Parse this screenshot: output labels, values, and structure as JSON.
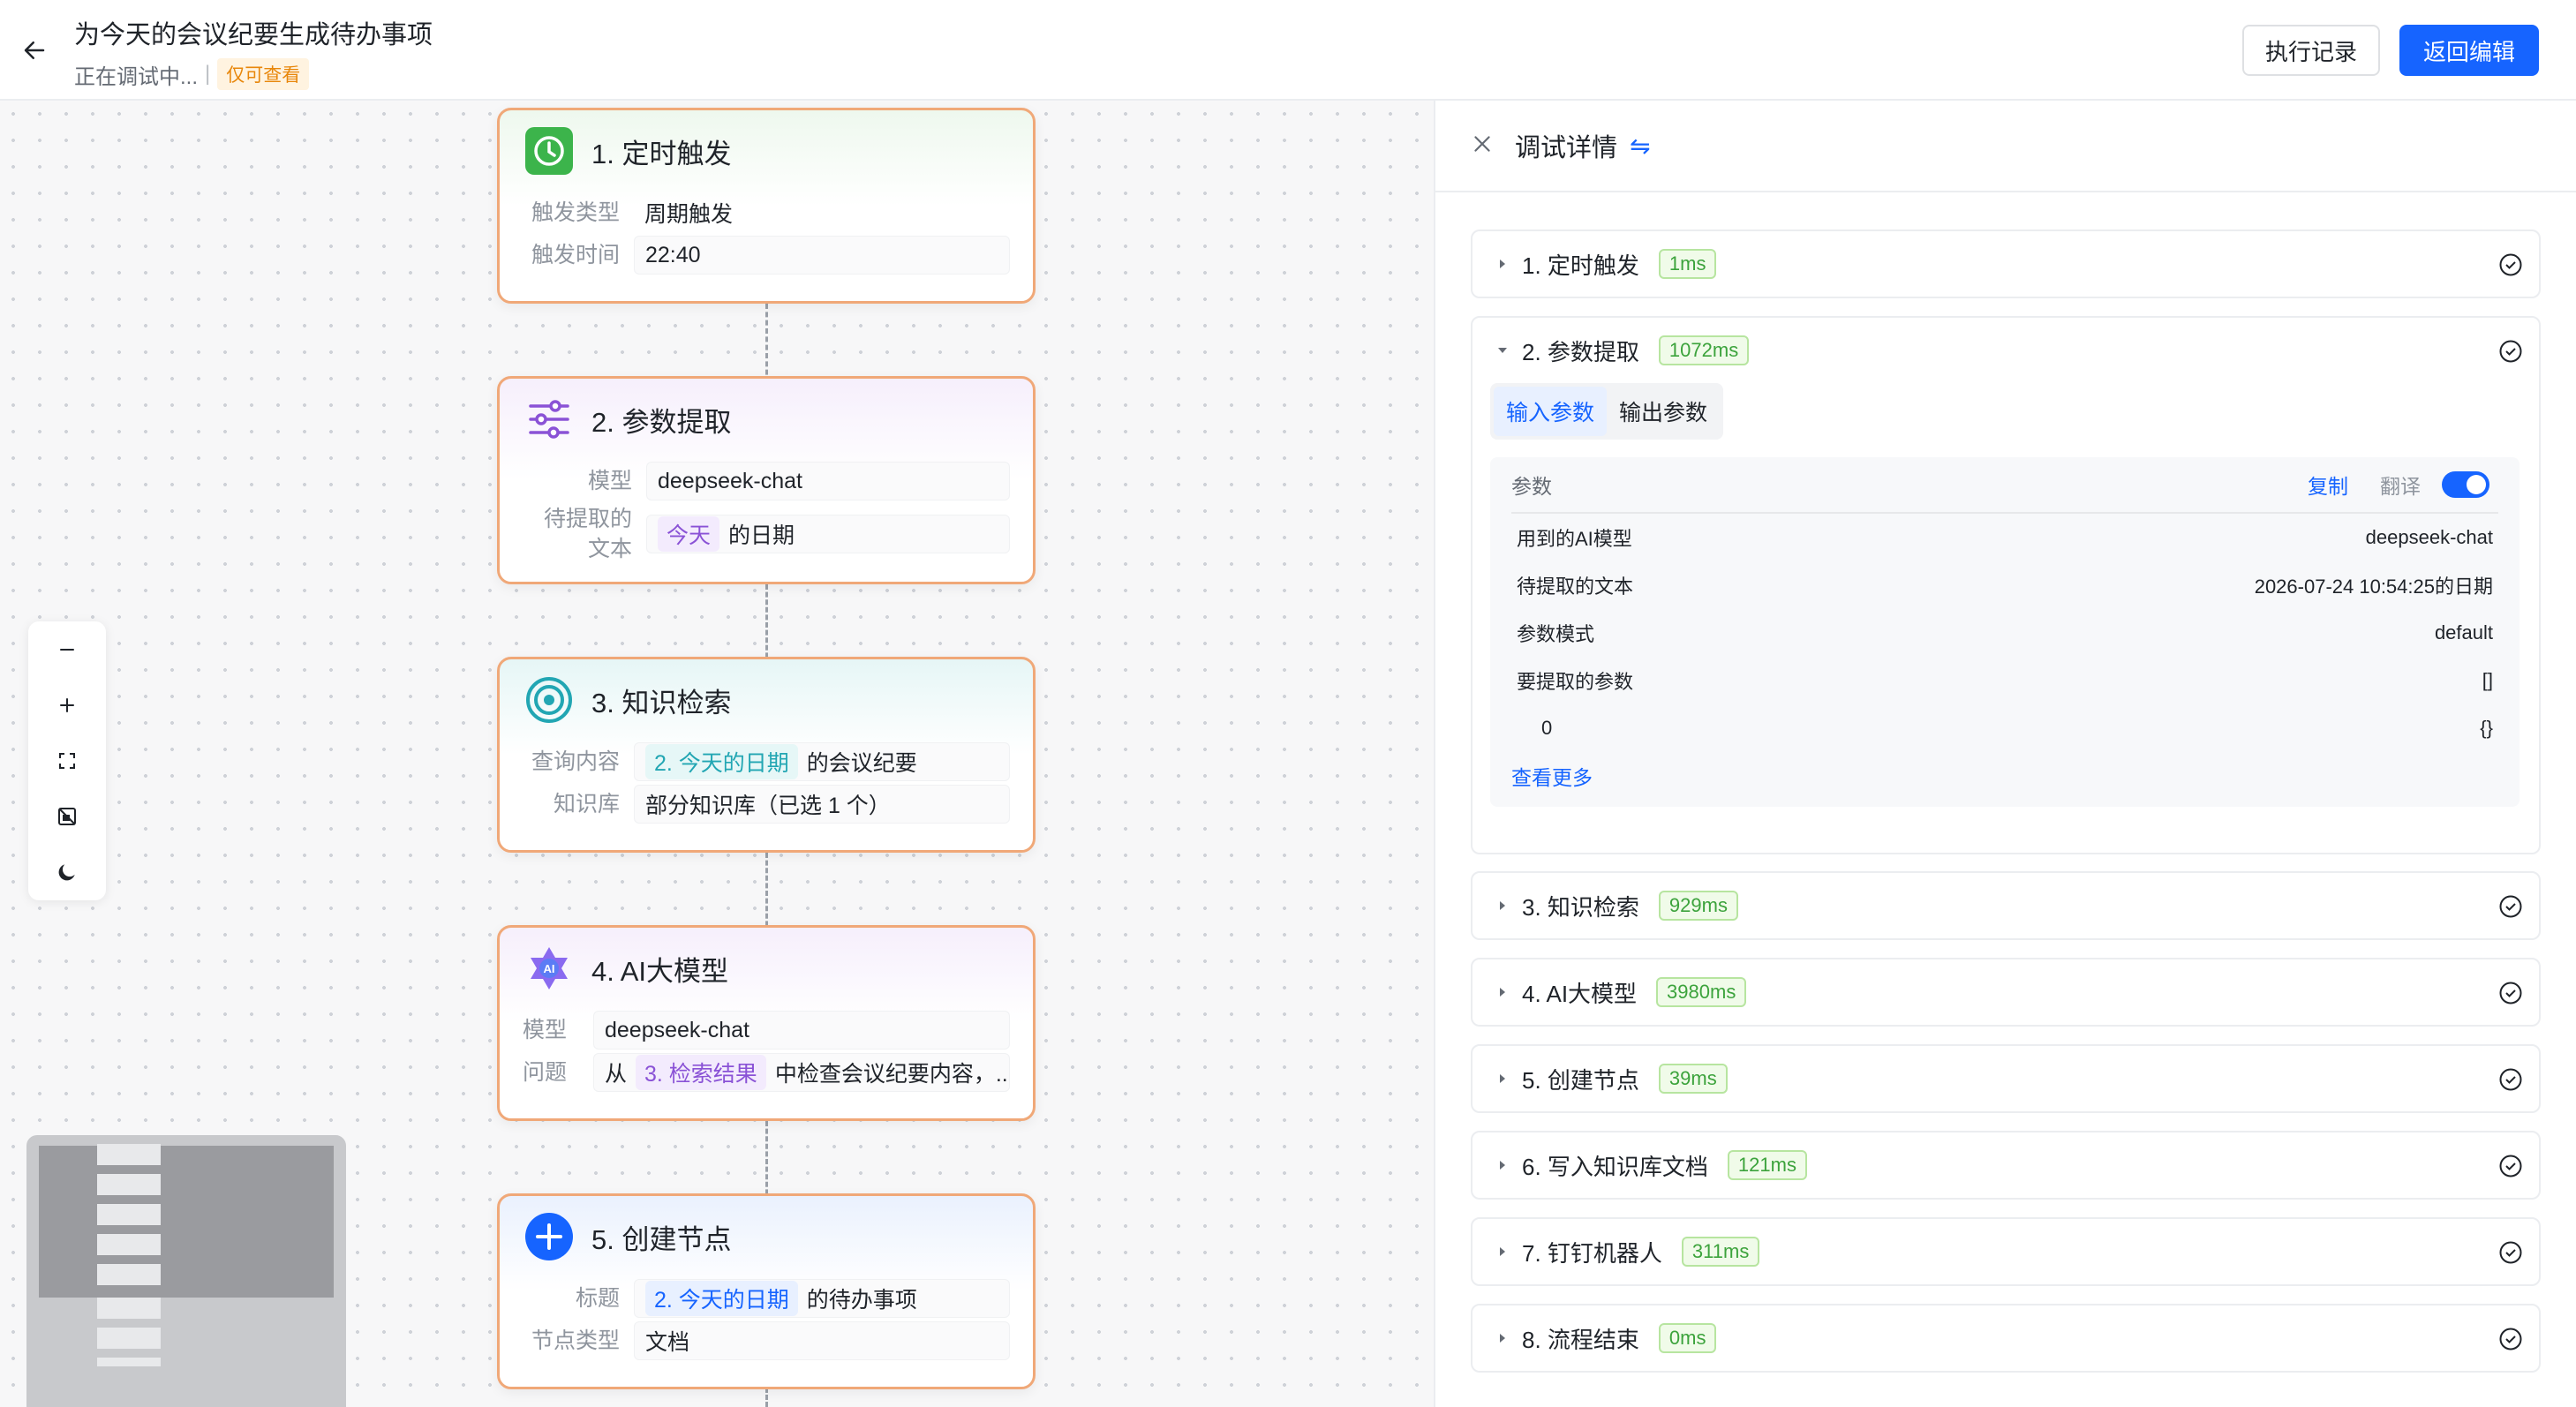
{
  "header": {
    "title": "为今天的会议纪要生成待办事项",
    "status": "正在调试中...",
    "separator": "|",
    "readonly_badge": "仅可查看",
    "history_button": "执行记录",
    "edit_button": "返回编辑"
  },
  "nodes": [
    {
      "title": "1. 定时触发",
      "rows": [
        {
          "label": "触发类型",
          "value": "周期触发"
        },
        {
          "label": "触发时间",
          "value": "22:40"
        }
      ]
    },
    {
      "title": "2. 参数提取",
      "rows": [
        {
          "label": "模型",
          "value": "deepseek-chat"
        },
        {
          "label": "待提取的文本",
          "tag": "今天",
          "value": "的日期"
        }
      ]
    },
    {
      "title": "3. 知识检索",
      "rows": [
        {
          "label": "查询内容",
          "tag": "2. 今天的日期",
          "value": "的会议纪要"
        },
        {
          "label": "知识库",
          "value": "部分知识库（已选 1 个）"
        }
      ]
    },
    {
      "title": "4. AI大模型",
      "rows": [
        {
          "label": "模型",
          "value": "deepseek-chat"
        },
        {
          "label": "问题",
          "prefix": "从",
          "tag": "3. 检索结果",
          "value": "中检查会议纪要内容，..."
        }
      ]
    },
    {
      "title": "5. 创建节点",
      "rows": [
        {
          "label": "标题",
          "tag": "2. 今天的日期",
          "value": "的待办事项"
        },
        {
          "label": "节点类型",
          "value": "文档"
        }
      ]
    }
  ],
  "panel": {
    "title": "调试详情",
    "steps": [
      {
        "name": "1. 定时触发",
        "time": "1ms"
      },
      {
        "name": "2. 参数提取",
        "time": "1072ms"
      },
      {
        "name": "3. 知识检索",
        "time": "929ms"
      },
      {
        "name": "4. AI大模型",
        "time": "3980ms"
      },
      {
        "name": "5. 创建节点",
        "time": "39ms"
      },
      {
        "name": "6. 写入知识库文档",
        "time": "121ms"
      },
      {
        "name": "7. 钉钉机器人",
        "time": "311ms"
      },
      {
        "name": "8. 流程结束",
        "time": "0ms"
      }
    ],
    "tabs": {
      "input": "输入参数",
      "output": "输出参数"
    },
    "params": {
      "label": "参数",
      "copy": "复制",
      "translate": "翻译",
      "rows": [
        {
          "key": "用到的AI模型",
          "value": "deepseek-chat"
        },
        {
          "key": "待提取的文本",
          "value": "2026-07-24 10:54:25的日期"
        },
        {
          "key": "参数模式",
          "value": "default"
        },
        {
          "key": "要提取的参数",
          "value": "[]"
        },
        {
          "key": "0",
          "value": "{}"
        }
      ],
      "more": "查看更多"
    }
  },
  "colors": {
    "accent": "#1664ff",
    "node_border": "#f0a878",
    "success": "#3ca33c"
  }
}
